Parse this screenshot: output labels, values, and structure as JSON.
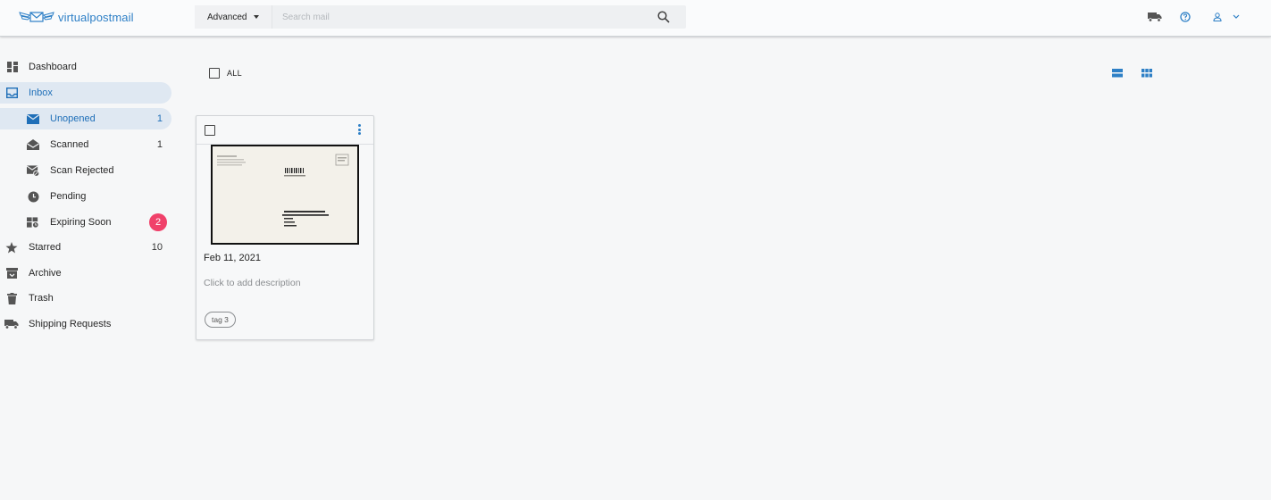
{
  "brand": {
    "name": "virtualpostmail",
    "accent": "#2d7fc6"
  },
  "search": {
    "advanced_label": "Advanced",
    "placeholder": "Search mail",
    "value": ""
  },
  "header_icons": [
    "truck-icon",
    "help-icon",
    "user-icon",
    "chevron-down-icon"
  ],
  "sidebar": {
    "items": [
      {
        "label": "Dashboard",
        "icon": "dashboard-icon",
        "count": ""
      },
      {
        "label": "Inbox",
        "icon": "inbox-icon",
        "count": "",
        "active": true
      },
      {
        "label": "Unopened",
        "icon": "envelope-closed-icon",
        "count": "1",
        "active": true
      },
      {
        "label": "Scanned",
        "icon": "envelope-open-icon",
        "count": "1"
      },
      {
        "label": "Scan Rejected",
        "icon": "envelope-rejected-icon",
        "count": ""
      },
      {
        "label": "Pending",
        "icon": "clock-icon",
        "count": ""
      },
      {
        "label": "Expiring Soon",
        "icon": "expiring-icon",
        "count": "2",
        "badge_color": "#f0416a"
      },
      {
        "label": "Starred",
        "icon": "star-icon",
        "count": "10"
      },
      {
        "label": "Archive",
        "icon": "archive-icon",
        "count": ""
      },
      {
        "label": "Trash",
        "icon": "trash-icon",
        "count": ""
      },
      {
        "label": "Shipping Requests",
        "icon": "truck-icon",
        "count": ""
      }
    ]
  },
  "main": {
    "select_all_label": "ALL",
    "view_modes": [
      "list-view-icon",
      "grid-view-icon"
    ],
    "mail_card": {
      "date": "Feb 11, 2021",
      "description_placeholder": "Click to add description",
      "tags": [
        "tag 3"
      ]
    }
  }
}
